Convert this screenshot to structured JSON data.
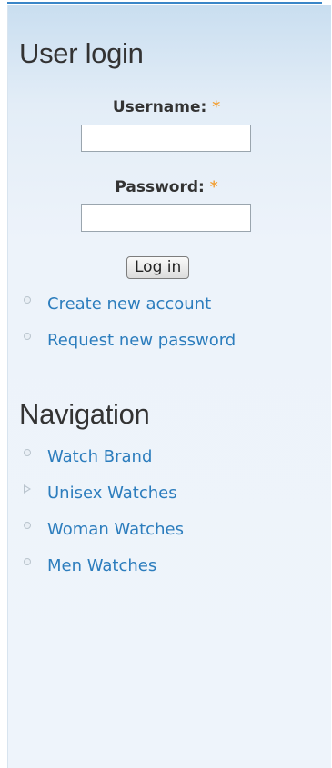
{
  "colors": {
    "link": "#2c7dbd",
    "title": "#333333",
    "required": "#f2a23a",
    "top_line": "#3a86c8",
    "sidebar_bg": "#eef4fb"
  },
  "user_login": {
    "title": "User login",
    "username_label": "Username:",
    "username_value": "",
    "password_label": "Password:",
    "password_value": "",
    "required_mark": "*",
    "login_button": "Log in",
    "links": [
      {
        "label": "Create new account",
        "bullet": "circle-bullet-icon"
      },
      {
        "label": "Request new password",
        "bullet": "circle-bullet-icon"
      }
    ]
  },
  "navigation": {
    "title": "Navigation",
    "items": [
      {
        "label": "Watch Brand",
        "bullet": "circle-bullet-icon"
      },
      {
        "label": "Unisex Watches",
        "bullet": "collapsed-triangle-icon"
      },
      {
        "label": "Woman Watches",
        "bullet": "circle-bullet-icon"
      },
      {
        "label": "Men Watches",
        "bullet": "circle-bullet-icon"
      }
    ]
  }
}
